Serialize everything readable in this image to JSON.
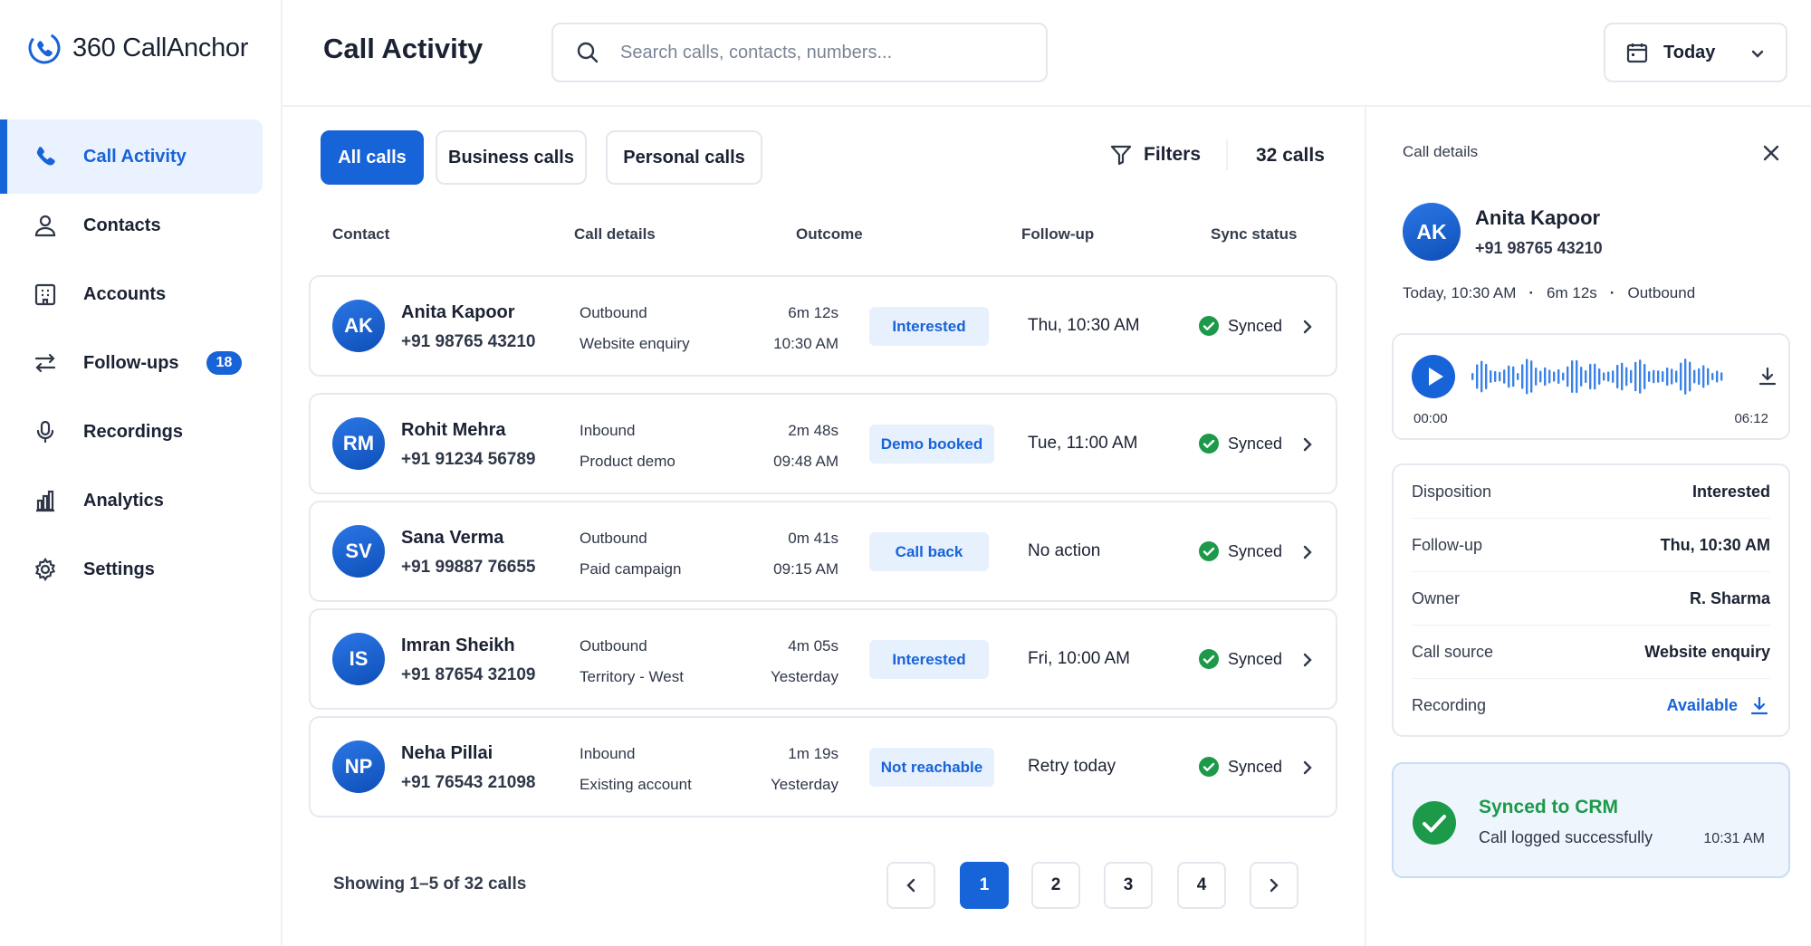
{
  "app": {
    "name": "360 CallAnchor"
  },
  "nav": [
    {
      "label": "Call Activity",
      "icon": "phone-icon",
      "active": true
    },
    {
      "label": "Contacts",
      "icon": "user-icon"
    },
    {
      "label": "Accounts",
      "icon": "building-icon"
    },
    {
      "label": "Follow-ups",
      "icon": "arrows-icon",
      "badge": "18"
    },
    {
      "label": "Recordings",
      "icon": "microphone-icon"
    },
    {
      "label": "Analytics",
      "icon": "bar-chart-icon"
    },
    {
      "label": "Settings",
      "icon": "gear-icon"
    }
  ],
  "header": {
    "title": "Call Activity",
    "search_placeholder": "Search calls, contacts, numbers...",
    "date_filter": "Today"
  },
  "tabs": [
    {
      "label": "All calls",
      "active": true
    },
    {
      "label": "Business calls"
    },
    {
      "label": "Personal calls"
    }
  ],
  "toolbar": {
    "filters_label": "Filters",
    "count_label": "32 calls"
  },
  "table": {
    "columns": [
      "Contact",
      "Call details",
      "Outcome",
      "Follow-up",
      "Sync status"
    ],
    "rows": [
      {
        "initials": "AK",
        "name": "Anita Kapoor",
        "phone": "+91 98765 43210",
        "direction": "Outbound",
        "source": "Website enquiry",
        "duration": "6m 12s",
        "time": "10:30 AM",
        "outcome": "Interested",
        "followup": "Thu, 10:30 AM",
        "sync": "Synced"
      },
      {
        "initials": "RM",
        "name": "Rohit Mehra",
        "phone": "+91 91234 56789",
        "direction": "Inbound",
        "source": "Product demo",
        "duration": "2m 48s",
        "time": "09:48 AM",
        "outcome": "Demo booked",
        "followup": "Tue, 11:00 AM",
        "sync": "Synced"
      },
      {
        "initials": "SV",
        "name": "Sana Verma",
        "phone": "+91 99887 76655",
        "direction": "Outbound",
        "source": "Paid campaign",
        "duration": "0m 41s",
        "time": "09:15 AM",
        "outcome": "Call back",
        "followup": "No action",
        "sync": "Synced"
      },
      {
        "initials": "IS",
        "name": "Imran Sheikh",
        "phone": "+91 87654 32109",
        "direction": "Outbound",
        "source": "Territory - West",
        "duration": "4m 05s",
        "time": "Yesterday",
        "outcome": "Interested",
        "followup": "Fri, 10:00 AM",
        "sync": "Synced"
      },
      {
        "initials": "NP",
        "name": "Neha Pillai",
        "phone": "+91 76543 21098",
        "direction": "Inbound",
        "source": "Existing account",
        "duration": "1m 19s",
        "time": "Yesterday",
        "outcome": "Not reachable",
        "followup": "Retry today",
        "sync": "Synced"
      }
    ]
  },
  "pagination": {
    "summary": "Showing 1–5 of 32 calls",
    "pages": [
      "1",
      "2",
      "3",
      "4"
    ],
    "current": "1"
  },
  "details": {
    "label": "Call details",
    "initials": "AK",
    "name": "Anita Kapoor",
    "phone": "+91 98765 43210",
    "meta": [
      "Today, 10:30 AM",
      "6m 12s",
      "Outbound"
    ],
    "meta_separator": "·",
    "player": {
      "start": "00:00",
      "end": "06:12"
    },
    "info": [
      {
        "key": "Disposition",
        "value": "Interested"
      },
      {
        "key": "Follow-up",
        "value": "Thu, 10:30 AM"
      },
      {
        "key": "Owner",
        "value": "R. Sharma"
      },
      {
        "key": "Call source",
        "value": "Website enquiry"
      },
      {
        "key": "Recording",
        "value": "Available",
        "link": true
      }
    ],
    "sync_card": {
      "title": "Synced to CRM",
      "subtitle": "Call logged successfully",
      "time": "10:31 AM"
    }
  },
  "colors": {
    "accent": "#1763d8",
    "accent_soft": "#eaf2ff",
    "success": "#1c9a4a",
    "text": "#1b2233",
    "border": "#e3e7ee"
  }
}
